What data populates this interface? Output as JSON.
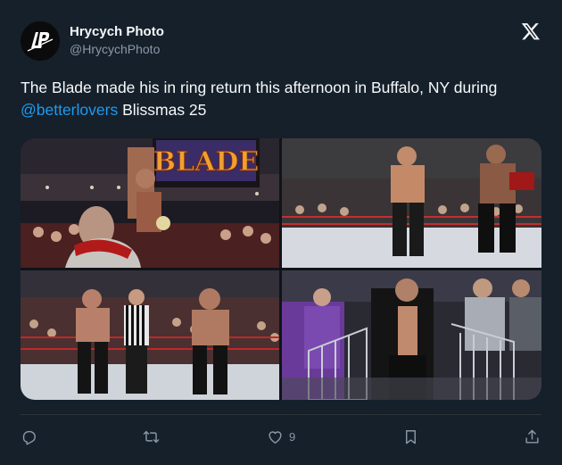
{
  "author": {
    "name": "Hrycych Photo",
    "handle": "@HrycychPhoto",
    "avatar_icon": "lp-logo-icon"
  },
  "tweet": {
    "text_before": "The Blade made his in ring return this afternoon in Buffalo, NY during ",
    "mention": "@betterlovers",
    "text_after": " Blissmas 25"
  },
  "media": {
    "photos": [
      {
        "name": "photo-blade-entrance",
        "sign_text": "BLADE"
      },
      {
        "name": "photo-ring-mic"
      },
      {
        "name": "photo-ring-referee"
      },
      {
        "name": "photo-crowd-walk"
      }
    ]
  },
  "actions": {
    "reply_icon": "reply-icon",
    "retweet_icon": "retweet-icon",
    "like_icon": "heart-icon",
    "like_count": "9",
    "bookmark_icon": "bookmark-icon",
    "share_icon": "share-icon"
  },
  "colors": {
    "background": "#15202b",
    "text": "#f7f9f9",
    "secondary": "#8b98a5",
    "link": "#1d9bf0",
    "divider": "#2f3336"
  }
}
